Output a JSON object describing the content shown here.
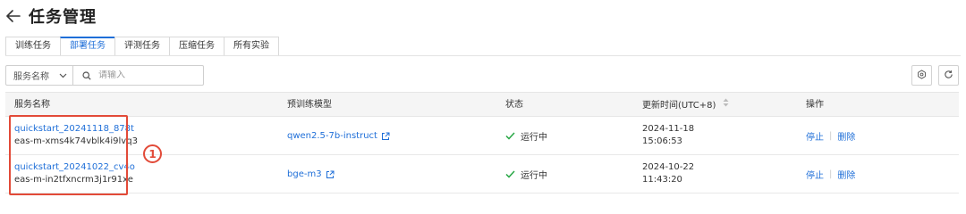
{
  "header": {
    "back_icon": "arrow-left-icon",
    "title": "任务管理"
  },
  "tabs": [
    {
      "label": "训练任务",
      "active": false
    },
    {
      "label": "部署任务",
      "active": true
    },
    {
      "label": "评测任务",
      "active": false
    },
    {
      "label": "压缩任务",
      "active": false
    },
    {
      "label": "所有实验",
      "active": false
    }
  ],
  "filter": {
    "field_label": "服务名称",
    "search_placeholder": "请输入",
    "search_value": ""
  },
  "toolbar": {
    "settings_icon": "gear-icon",
    "refresh_icon": "refresh-icon"
  },
  "table": {
    "columns": {
      "name": "服务名称",
      "model": "预训练模型",
      "status": "状态",
      "updated": "更新时间(UTC+8)",
      "actions": "操作"
    },
    "rows": [
      {
        "service_name": "quickstart_20241118_878t",
        "service_id": "eas-m-xms4k74vblk4i9lvq3",
        "model": "qwen2.5-7b-instruct",
        "status": "运行中",
        "date": "2024-11-18",
        "time": "15:06:53",
        "stop": "停止",
        "delete": "删除"
      },
      {
        "service_name": "quickstart_20241022_cv4o",
        "service_id": "eas-m-in2tfxncrm3j1r91xe",
        "model": "bge-m3",
        "status": "运行中",
        "date": "2024-10-22",
        "time": "11:43:20",
        "stop": "停止",
        "delete": "删除"
      }
    ]
  },
  "annotation": {
    "marker": "1",
    "color": "#e24a38"
  },
  "colors": {
    "link": "#1f6fd8",
    "success": "#28a745"
  }
}
